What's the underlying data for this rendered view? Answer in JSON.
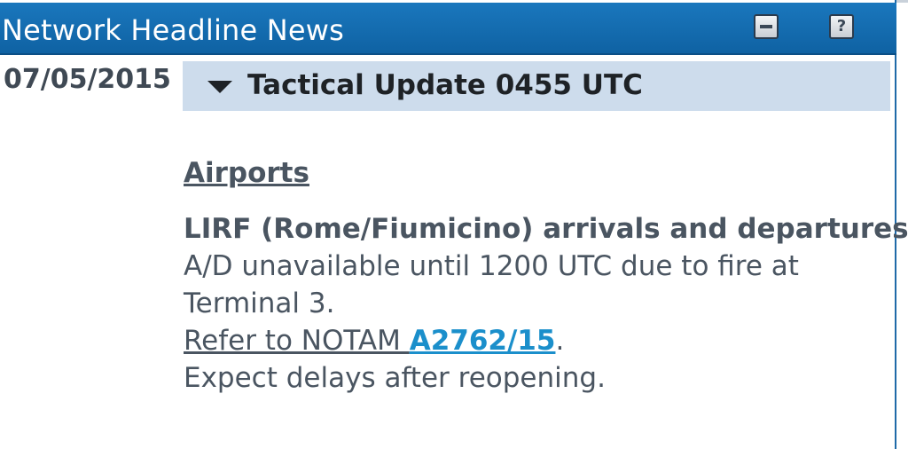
{
  "widget": {
    "title": "Network Headline News",
    "buttons": {
      "minimize_icon": "minus-icon",
      "help_icon": "question-icon",
      "help_glyph": "?"
    }
  },
  "news": {
    "date": "07/05/2015",
    "update_title": "Tactical Update 0455 UTC",
    "section_heading": "Airports",
    "subject": "LIRF (Rome/Fiumicino) arrivals and departures",
    "body_line_1": "A/D unavailable until 1200 UTC due to fire at",
    "body_line_2": "Terminal 3.",
    "refer_text": "Refer to NOTAM ",
    "notam_link": "A2762/15",
    "refer_suffix": ".",
    "body_line_4": "Expect delays after reopening."
  },
  "colors": {
    "titlebar": "#1a77bd",
    "header_band": "#cddcec",
    "link": "#1b8fcb",
    "text": "#4a5561"
  }
}
